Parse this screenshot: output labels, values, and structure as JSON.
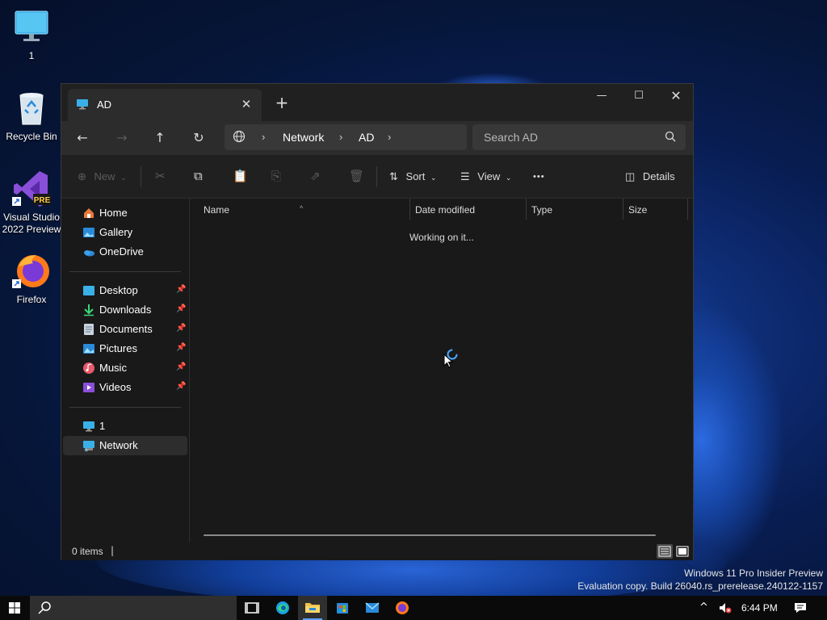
{
  "desktop": {
    "icons": [
      {
        "label": "1"
      },
      {
        "label": "Recycle Bin"
      },
      {
        "label": "Visual Studio 2022 Preview",
        "badge": "PRE"
      },
      {
        "label": "Firefox"
      }
    ]
  },
  "window": {
    "tab_title": "AD",
    "new_tab_glyph": "+",
    "addressbar": {
      "breadcrumb": [
        "Network",
        "AD"
      ],
      "search_placeholder": "Search AD"
    },
    "commandbar": {
      "new_label": "New",
      "sort_label": "Sort",
      "view_label": "View",
      "more_glyph": "•••",
      "details_label": "Details"
    },
    "sidebar": {
      "top": [
        {
          "label": "Home",
          "icon": "home-icon"
        },
        {
          "label": "Gallery",
          "icon": "gallery-icon"
        },
        {
          "label": "OneDrive",
          "icon": "onedrive-icon"
        }
      ],
      "quick_access": [
        {
          "label": "Desktop",
          "icon": "desktop-folder-icon",
          "pinned": true
        },
        {
          "label": "Downloads",
          "icon": "downloads-icon",
          "pinned": true
        },
        {
          "label": "Documents",
          "icon": "documents-icon",
          "pinned": true
        },
        {
          "label": "Pictures",
          "icon": "pictures-icon",
          "pinned": true
        },
        {
          "label": "Music",
          "icon": "music-icon",
          "pinned": true
        },
        {
          "label": "Videos",
          "icon": "videos-icon",
          "pinned": true
        }
      ],
      "locations": [
        {
          "label": "1",
          "icon": "this-pc-icon"
        },
        {
          "label": "Network",
          "icon": "network-icon",
          "selected": true
        }
      ]
    },
    "columns": [
      "Name",
      "Date modified",
      "Type",
      "Size"
    ],
    "loading_text": "Working on it...",
    "status": {
      "items_text": "0 items",
      "caret": "|"
    }
  },
  "watermark": {
    "line1": "Windows 11 Pro Insider Preview",
    "line2": "Evaluation copy. Build 26040.rs_prerelease.240122-1157"
  },
  "taskbar": {
    "clock": "6:44 PM",
    "accent": "#5aa0ff"
  }
}
